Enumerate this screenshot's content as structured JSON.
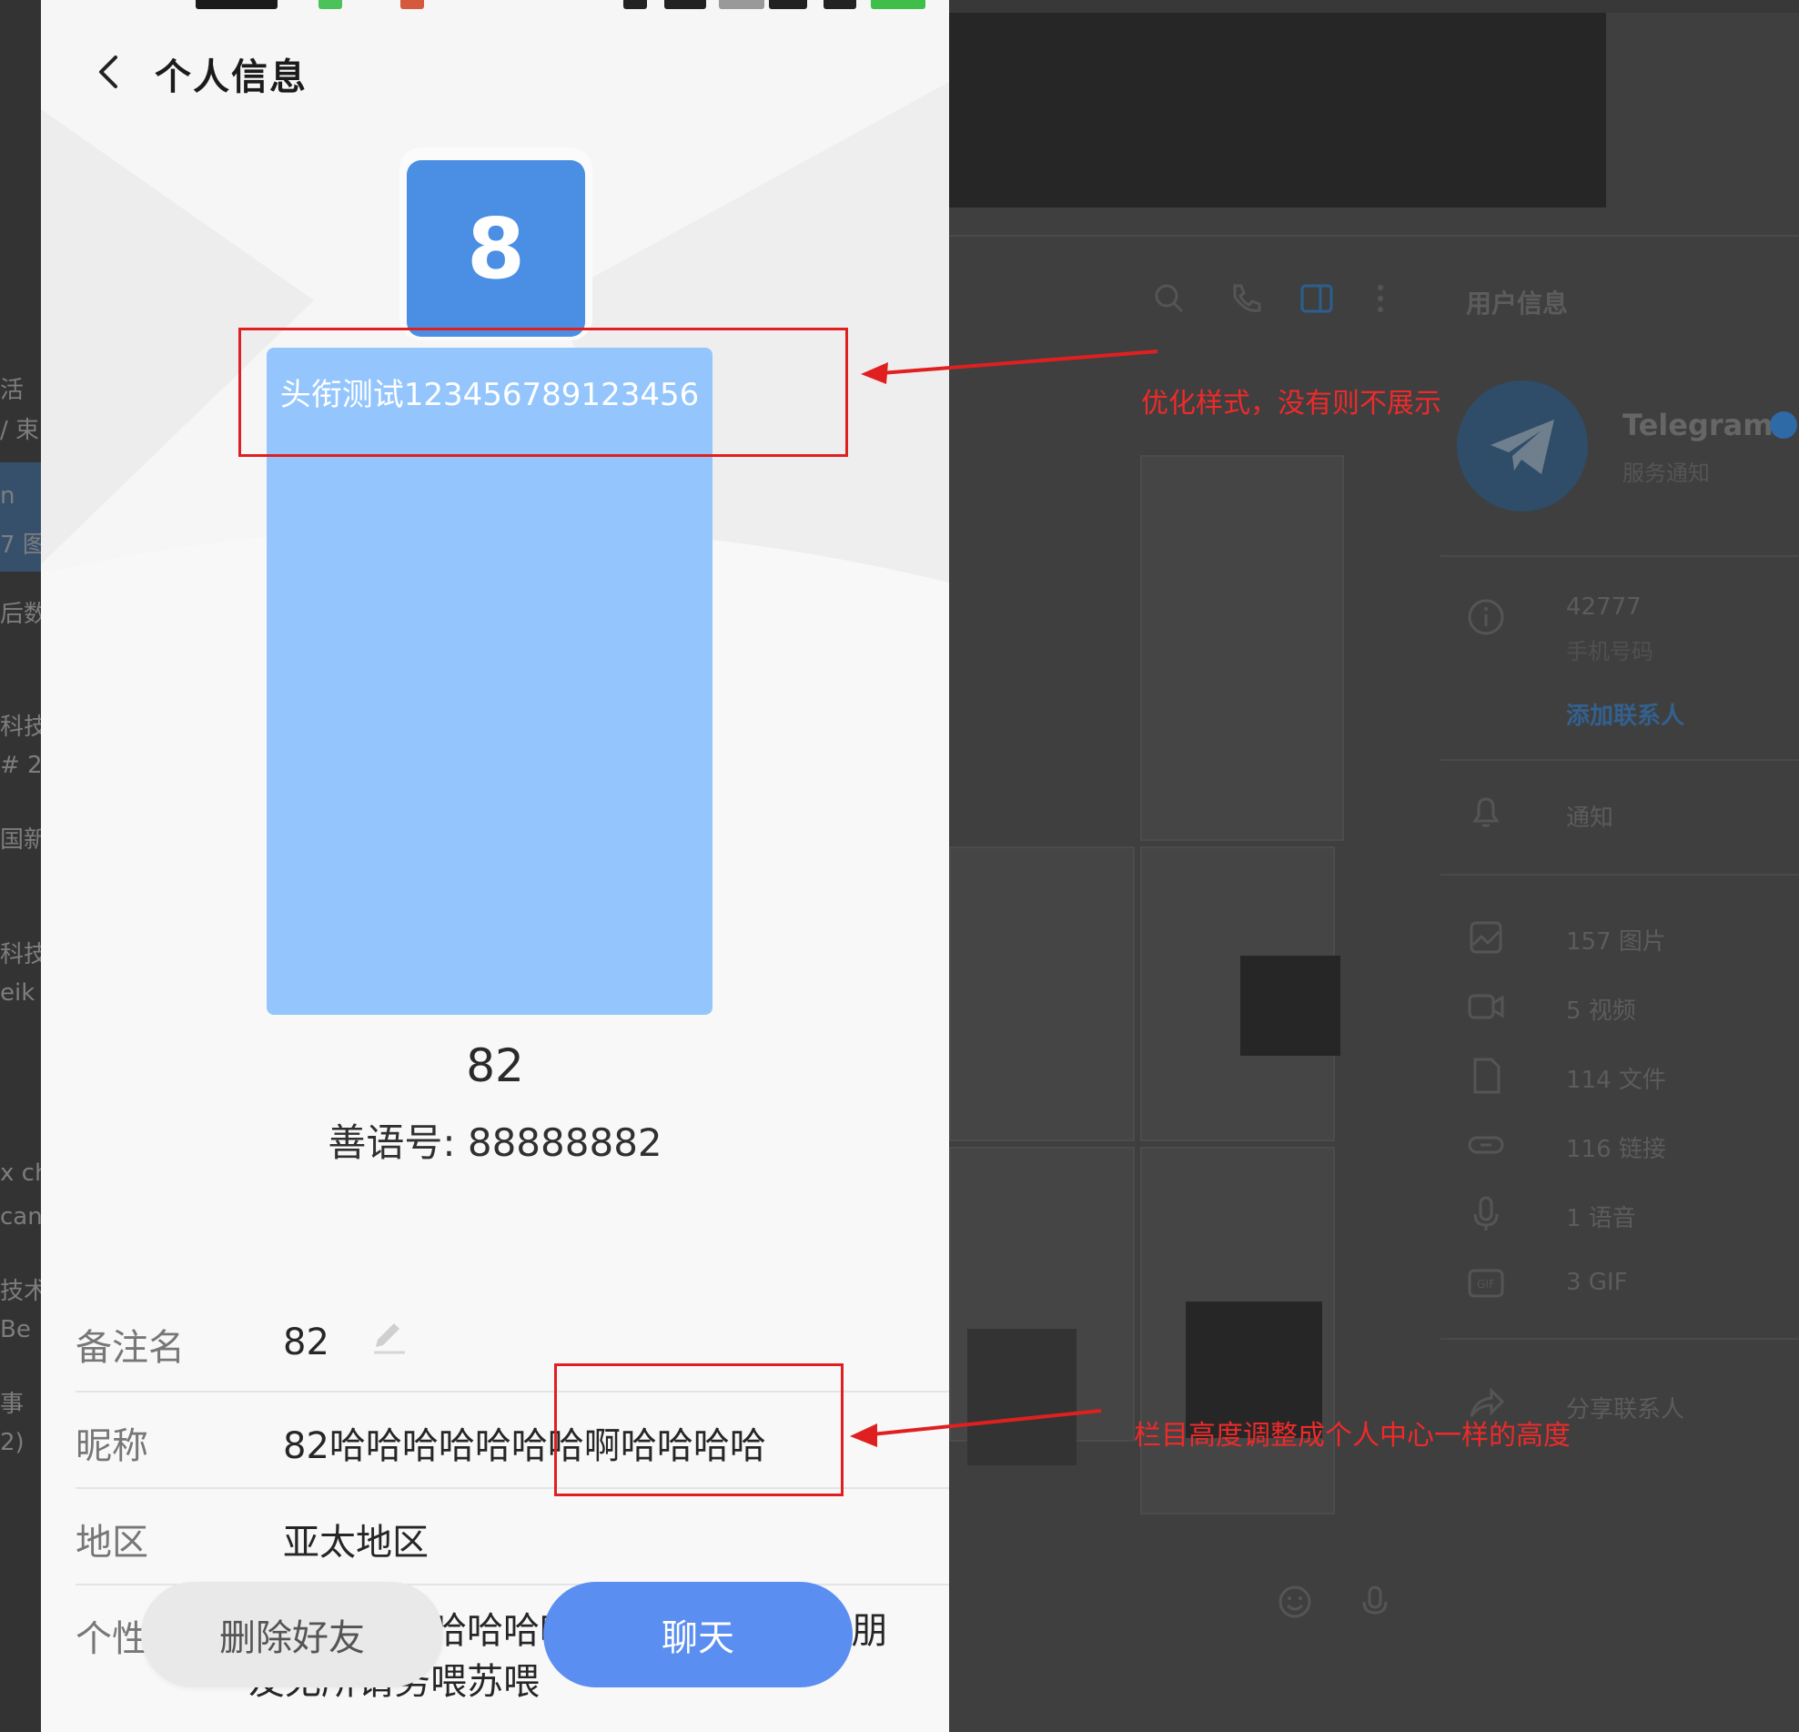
{
  "phone": {
    "title": "个人信息",
    "avatar_text": "8",
    "title_badge": "头衔测试123456789123456",
    "display_name": "82",
    "account_label": "善语号: ",
    "account_id": "88888882",
    "rows": [
      {
        "label": "备注名",
        "value": "82"
      },
      {
        "label": "昵称",
        "value": "82哈哈哈哈哈哈哈啊哈哈哈哈"
      },
      {
        "label": "地区",
        "value": "亚太地区"
      },
      {
        "label": "个性",
        "value": "哈哈哈哈啊哈哈哈哈您哈QWQ我让我朋友无所谓务喂苏喂"
      }
    ],
    "buttons": {
      "delete": "删除好友",
      "chat": "聊天"
    }
  },
  "annotations": {
    "note_title": "优化样式，没有则不展示",
    "note_row": "栏目高度调整成个人中心一样的高度"
  },
  "background_app": {
    "panel_title": "用户信息",
    "contact_name": "Telegram",
    "contact_sub": "服务通知",
    "phone_number": "42777",
    "phone_label": "手机号码",
    "add_contact": "添加联系人",
    "notifications": "通知",
    "media": [
      {
        "icon": "image-icon",
        "text": "157 图片"
      },
      {
        "icon": "video-icon",
        "text": "5 视频"
      },
      {
        "icon": "file-icon",
        "text": "114 文件"
      },
      {
        "icon": "link-icon",
        "text": "116 链接"
      },
      {
        "icon": "mic-icon",
        "text": "1 语音"
      },
      {
        "icon": "gif-icon",
        "text": "3 GIF"
      }
    ],
    "share_contact": "分享联系人",
    "left_list_fragments": [
      "活",
      "/ 束",
      "n",
      "7 图",
      "后数",
      "科技",
      "# 2",
      "国新",
      "科技",
      "eik",
      "x ch",
      "can",
      "技术",
      "Be",
      "事",
      "2)"
    ]
  },
  "colors": {
    "avatar": "#4a8fe3",
    "title_card": "#94c6fd",
    "chat_button": "#5a8ef0",
    "annotation_red": "#e02020"
  }
}
